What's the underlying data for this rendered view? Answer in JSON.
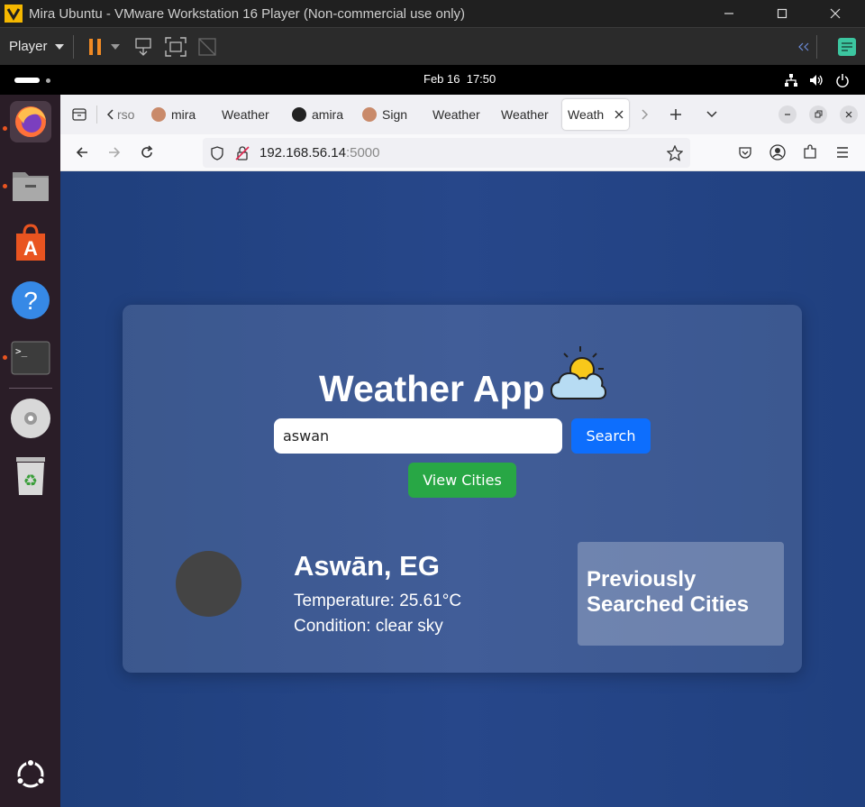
{
  "vm": {
    "title": "Mira Ubuntu - VMware Workstation 16 Player (Non-commercial use only)",
    "player_label": "Player"
  },
  "ubuntu": {
    "date": "Feb 16",
    "time": "17:50"
  },
  "browser": {
    "tabs": [
      {
        "label": "rso"
      },
      {
        "label": "mira"
      },
      {
        "label": "Weather"
      },
      {
        "label": "amira"
      },
      {
        "label": "Sign"
      },
      {
        "label": "Weather"
      },
      {
        "label": "Weather"
      },
      {
        "label": "Weath"
      }
    ],
    "url_host": "192.168.56.14",
    "url_port": ":5000"
  },
  "app": {
    "title": "Weather App",
    "search_value": "aswan",
    "search_button": "Search",
    "view_cities_button": "View Cities",
    "city": "Aswān, EG",
    "temperature": "Temperature: 25.61°C",
    "condition": "Condition: clear sky",
    "previous_title": "Previously Searched Cities"
  },
  "colors": {
    "accent_search": "#0d6efd",
    "accent_cities": "#28a745",
    "page_bg": "#27478a"
  }
}
